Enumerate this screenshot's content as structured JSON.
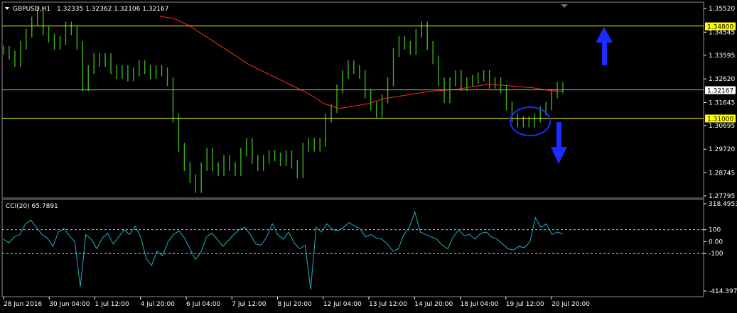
{
  "header": {
    "symbol": "GBPUSD,H1",
    "ohlc": "1.32335 1.32362 1.32106 1.32167"
  },
  "indicator": {
    "label": "CCI(20) 65.7891"
  },
  "colors": {
    "background": "#000000",
    "price": "#3cb31a",
    "ma": "#ff2a1e",
    "level_line": "#ffff00",
    "current_line": "#b0b0b0",
    "cci": "#1fb3c2",
    "annotation": "#1a2cff",
    "frame": "#8a8a8a"
  },
  "chart_data": [
    {
      "type": "bar",
      "title": "GBPUSD,H1",
      "ylim": [
        1.27795,
        1.3552
      ],
      "y_ticks": [
        "1.35520",
        "1.34545",
        "1.33595",
        "1.32620",
        "1.31645",
        "1.30695",
        "1.29720",
        "1.28745",
        "1.27795"
      ],
      "x_ticks": [
        "28 Jun 2016",
        "30 Jun 04:00",
        "1 Jul 12:00",
        "4 Jul 20:00",
        "6 Jul 04:00",
        "7 Jul 12:00",
        "8 Jul 20:00",
        "12 Jul 04:00",
        "13 Jul 12:00",
        "14 Jul 20:00",
        "18 Jul 04:00",
        "19 Jul 12:00",
        "20 Jul 20:00"
      ],
      "horizontal_levels": [
        {
          "value": 1.348,
          "label": "1.34800"
        },
        {
          "value": 1.31,
          "label": "1.31000"
        }
      ],
      "current_price": {
        "value": 1.32167,
        "label": "1.32167"
      },
      "series": [
        {
          "values": [
            1.338,
            1.336,
            1.333,
            1.34,
            1.345,
            1.35,
            1.354,
            1.346,
            1.343,
            1.34,
            1.342,
            1.348,
            1.346,
            1.34,
            1.323,
            1.33,
            1.335,
            1.333,
            1.335,
            1.33,
            1.328,
            1.33,
            1.327,
            1.329,
            1.332,
            1.33,
            1.328,
            1.33,
            1.329,
            1.325,
            1.31,
            1.298,
            1.29,
            1.285,
            1.281,
            1.29,
            1.296,
            1.29,
            1.288,
            1.293,
            1.29,
            1.288,
            1.296,
            1.3,
            1.293,
            1.29,
            1.293,
            1.295,
            1.294,
            1.292,
            1.295,
            1.291,
            1.287,
            1.298,
            1.3,
            1.298,
            1.3,
            1.31,
            1.314,
            1.322,
            1.328,
            1.332,
            1.33,
            1.328,
            1.32,
            1.315,
            1.312,
            1.318,
            1.325,
            1.337,
            1.342,
            1.34,
            1.338,
            1.345,
            1.348,
            1.34,
            1.334,
            1.325,
            1.318,
            1.325,
            1.328,
            1.323,
            1.325,
            1.326,
            1.327,
            1.328,
            1.324,
            1.325,
            1.322,
            1.315,
            1.31,
            1.308,
            1.309,
            1.308,
            1.31,
            1.313,
            1.315,
            1.32,
            1.323,
            1.322
          ]
        },
        {
          "name": "",
          "values": [
            1.352,
            1.351,
            1.348,
            1.344,
            1.34,
            1.336,
            1.332,
            1.329,
            1.326,
            1.323,
            1.32,
            1.316,
            1.314,
            1.315,
            1.316,
            1.318,
            1.319,
            1.32,
            1.321,
            1.3215,
            1.322,
            1.323,
            1.324,
            1.3235,
            1.323,
            1.3225,
            1.3215,
            1.321
          ]
        }
      ]
    },
    {
      "type": "line",
      "title": "CCI(20) 65.7891",
      "ylim": [
        -414.3973,
        318.4953
      ],
      "y_ticks": [
        "318.4953",
        "100",
        "0.00",
        "-100",
        "-414.3973"
      ],
      "levels": [
        100,
        -100
      ],
      "series": [
        {
          "name": "CCI(20)",
          "values": [
            20,
            -10,
            40,
            60,
            150,
            180,
            120,
            60,
            30,
            -40,
            80,
            110,
            50,
            0,
            -380,
            60,
            20,
            -60,
            30,
            70,
            -20,
            40,
            100,
            60,
            130,
            40,
            -140,
            -200,
            -80,
            -120,
            0,
            60,
            90,
            30,
            -60,
            -150,
            -90,
            40,
            70,
            20,
            -40,
            10,
            60,
            100,
            120,
            60,
            -20,
            -30,
            40,
            150,
            60,
            20,
            80,
            -10,
            -60,
            -30,
            -400,
            120,
            80,
            150,
            100,
            90,
            120,
            160,
            130,
            110,
            40,
            60,
            30,
            20,
            -20,
            -80,
            -60,
            60,
            120,
            250,
            80,
            60,
            40,
            20,
            -30,
            -60,
            40,
            100,
            50,
            60,
            20,
            70,
            80,
            40,
            20,
            -20,
            -60,
            -70,
            -40,
            -50,
            0,
            200,
            120,
            150,
            60,
            80,
            65.79
          ]
        }
      ]
    }
  ]
}
